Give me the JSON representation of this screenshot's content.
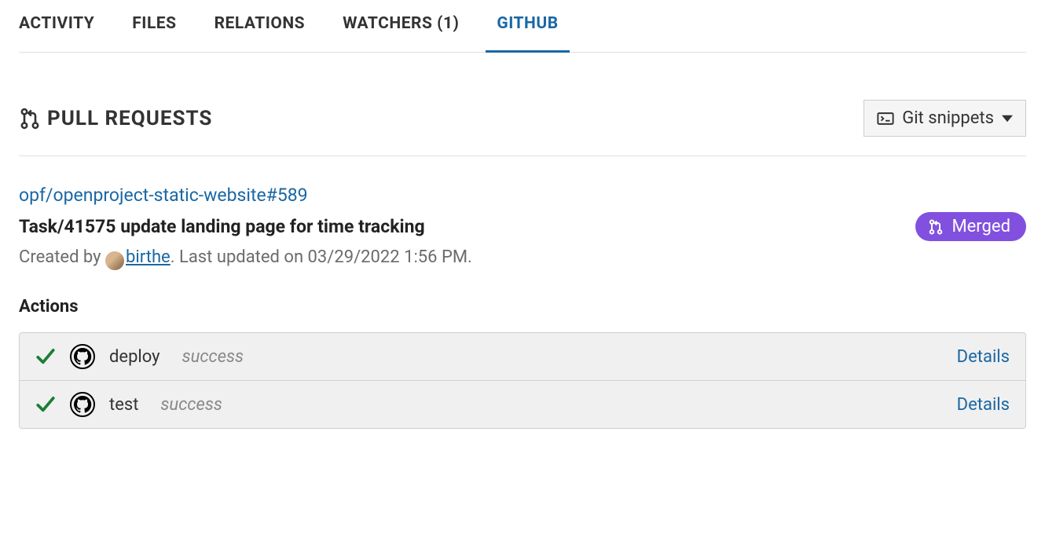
{
  "tabs": {
    "activity": "ACTIVITY",
    "files": "FILES",
    "relations": "RELATIONS",
    "watchers": "WATCHERS (1)",
    "github": "GITHUB"
  },
  "section": {
    "title": "PULL REQUESTS",
    "git_snippets": "Git snippets"
  },
  "pr": {
    "repo_link": "opf/openproject-static-website#589",
    "title": "Task/41575 update landing page for time tracking",
    "merged_label": "Merged",
    "created_by_prefix": "Created by ",
    "username": "birthe",
    "updated_suffix": ". Last updated on 03/29/2022 1:56 PM."
  },
  "actions": {
    "heading": "Actions",
    "rows": [
      {
        "name": "deploy",
        "status": "success",
        "details": "Details"
      },
      {
        "name": "test",
        "status": "success",
        "details": "Details"
      }
    ]
  }
}
